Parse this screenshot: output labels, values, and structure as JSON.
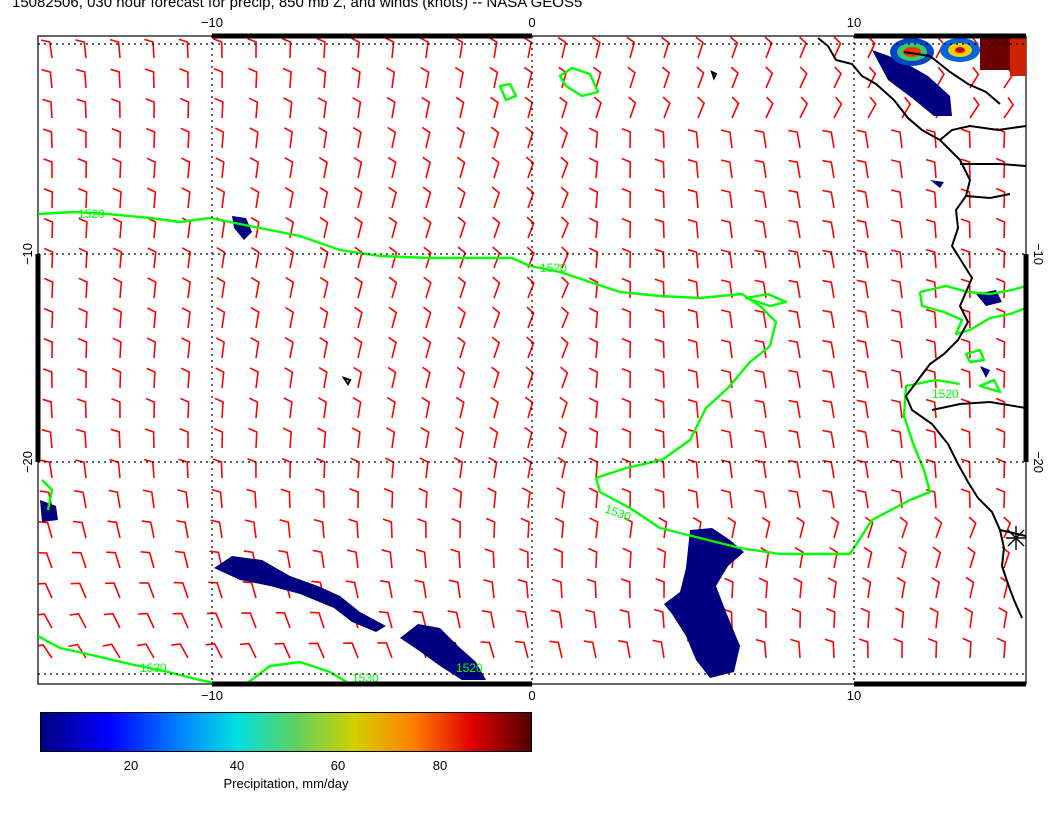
{
  "title": "15082506, 030 hour forecast for precip, 850 mb Z, and winds (knots) -- NASA GEOS5",
  "colors": {
    "wind_barbs": "#ff0000",
    "height_contours": "#00ff00",
    "coastline": "#000000",
    "precip_low": "#000080"
  },
  "map": {
    "lon_range": [
      -15,
      16
    ],
    "lat_range": [
      -31,
      -1
    ],
    "x_ticks": [
      "−10",
      "0",
      "10"
    ],
    "y_ticks": [
      "−10",
      "−20"
    ],
    "contour_labels": [
      "1520",
      "1520",
      "1530",
      "1520",
      "1530",
      "1530",
      "1520"
    ]
  },
  "colorbar": {
    "label": "Precipitation, mm/day",
    "ticks": [
      "20",
      "40",
      "60",
      "80"
    ]
  }
}
